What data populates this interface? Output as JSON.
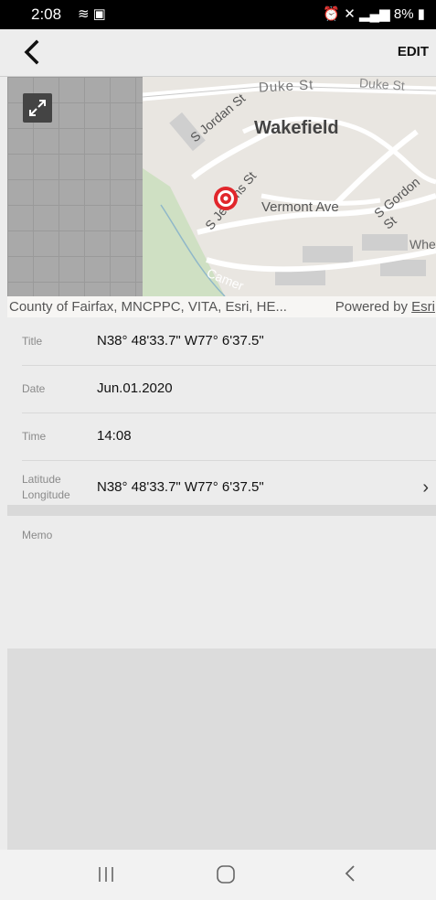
{
  "status_bar": {
    "time": "2:08",
    "left_icons": [
      "wifi-hotspot-icon",
      "image-icon"
    ],
    "right_text": "8%"
  },
  "app_bar": {
    "back_icon": "chevron-left-icon",
    "edit_label": "EDIT"
  },
  "map": {
    "labels": {
      "duke_st": "Duke St",
      "duke_st_2": "Duke St",
      "wakefield": "Wakefield",
      "s_jordan_st": "S Jordan St",
      "s_jenkins_st": "S Jenkins St",
      "vermont_ave": "Vermont Ave",
      "s_gordon_st": "S Gordon St",
      "wh": "Whe",
      "camer": "Camer"
    },
    "attribution": "County of Fairfax, MNCPPC, VITA, Esri, HE...",
    "powered_by": "Powered by",
    "esri": "Esri",
    "marker_color": "#e1262b"
  },
  "details": {
    "title_label": "Title",
    "title_value": "N38° 48'33.7\" W77° 6'37.5\"",
    "date_label": "Date",
    "date_value": "Jun.01.2020",
    "time_label": "Time",
    "time_value": "14:08",
    "latitude_label": "Latitude",
    "longitude_label": "Longitude",
    "latlong_value": "N38° 48'33.7\" W77° 6'37.5\""
  },
  "memo": {
    "label": "Memo"
  }
}
